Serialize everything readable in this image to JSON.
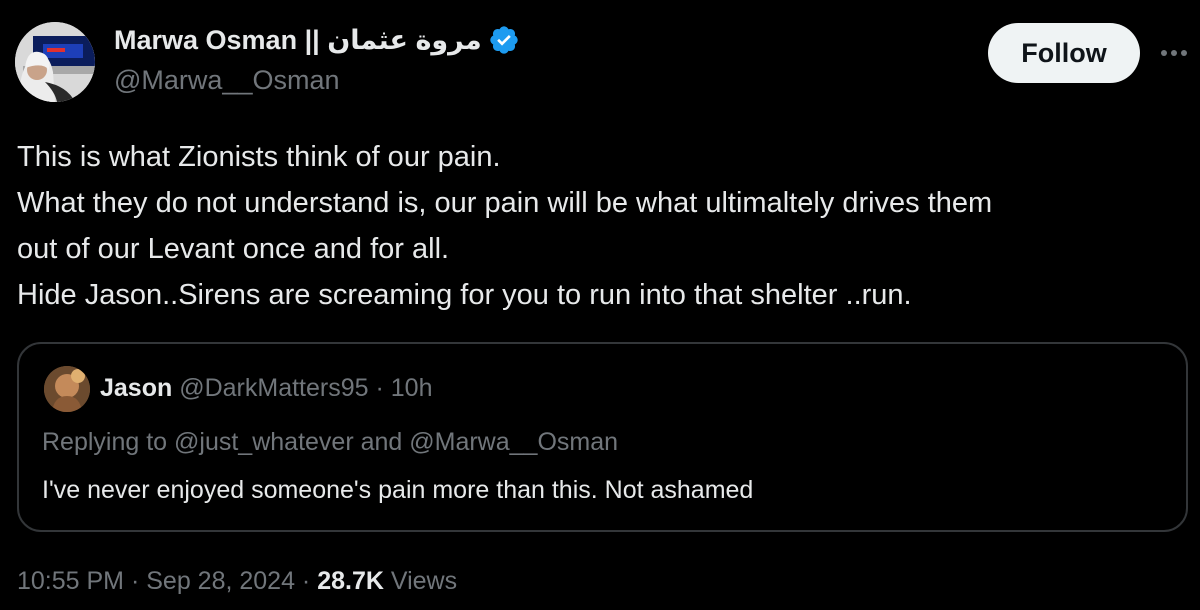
{
  "author": {
    "name": "Marwa Osman || مروة عثمان",
    "handle": "@Marwa__Osman",
    "verified": true
  },
  "follow_label": "Follow",
  "more_icon": "more-horizontal-icon",
  "tweet_text": [
    "This is what Zionists think of our pain.",
    "What they do not understand is, our pain will be what ultimaltely drives them",
    "out of our Levant once and for all.",
    "Hide Jason..Sirens are screaming for you to run into that shelter ..run."
  ],
  "quote": {
    "name": "Jason",
    "handle": "@DarkMatters95",
    "separator": " · ",
    "time": "10h",
    "replying_to": "Replying to @just_whatever and @Marwa__Osman",
    "text": "I've never enjoyed someone's pain more than this. Not ashamed"
  },
  "footer": {
    "time": "10:55 PM",
    "separator": " · ",
    "date": "Sep 28, 2024",
    "views_count": "28.7K",
    "views_label": "Views"
  },
  "colors": {
    "background": "#000000",
    "text_primary": "#e7e9ea",
    "text_secondary": "#71767b",
    "border": "#333639",
    "verified": "#1d9bf0",
    "follow_bg": "#eff3f4"
  }
}
